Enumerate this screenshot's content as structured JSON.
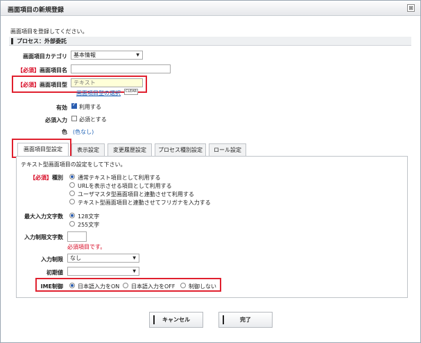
{
  "dialog": {
    "title": "画面項目の新規登録",
    "close_glyph": "⊠"
  },
  "intro": "画面項目を登録してください。",
  "section": "プロセス：外部委託",
  "form": {
    "category_label": "画面項目カテゴリ",
    "category_value": "基本情報",
    "required_tag": "【必須】",
    "name_label": "画面項目名",
    "name_value": "",
    "type_label": "画面項目型",
    "type_value": "テキスト",
    "type_select_link": "画面項目型の選択",
    "clear_label": "CLEAR",
    "enabled_label": "有効",
    "enabled_checked": true,
    "enabled_text": "利用する",
    "mandatory_label": "必須入力",
    "mandatory_checked": false,
    "mandatory_text": "必須とする",
    "color_label": "色",
    "color_value": "(色なし)"
  },
  "tabs": [
    {
      "label": "画面項目型設定",
      "active": true
    },
    {
      "label": "表示設定",
      "active": false
    },
    {
      "label": "変更履歴設定",
      "active": false
    },
    {
      "label": "プロセス種別設定",
      "active": false
    },
    {
      "label": "ロール設定",
      "active": false
    }
  ],
  "panel": {
    "description": "テキスト型画面項目の設定をして下さい。",
    "kind_label": "種別",
    "kind_options": [
      {
        "label": "通常テキスト項目として利用する",
        "selected": true
      },
      {
        "label": "URLを表示させる項目として利用する",
        "selected": false
      },
      {
        "label": "ユーザマスタ型画面項目と連動させて利用する",
        "selected": false
      },
      {
        "label": "テキスト型画面項目と連動させてフリガナを入力する",
        "selected": false
      }
    ],
    "maxlen_label": "最大入力文字数",
    "maxlen_options": [
      {
        "label": "128文字",
        "selected": true
      },
      {
        "label": "255文字",
        "selected": false
      }
    ],
    "limitlen_label": "入力制限文字数",
    "limitlen_value": "",
    "limitlen_error": "必須項目です。",
    "restrict_label": "入力制限",
    "restrict_value": "なし",
    "initial_label": "初期値",
    "initial_value": "",
    "ime_label": "IME制御",
    "ime_options": [
      {
        "label": "日本語入力をON",
        "selected": true
      },
      {
        "label": "日本語入力をOFF",
        "selected": false
      },
      {
        "label": "制御しない",
        "selected": false
      }
    ]
  },
  "buttons": {
    "cancel": "キャンセル",
    "done": "完了"
  },
  "colors": {
    "required": "#d6001c",
    "highlight": "#e0202e",
    "link": "#1a5fb4"
  }
}
